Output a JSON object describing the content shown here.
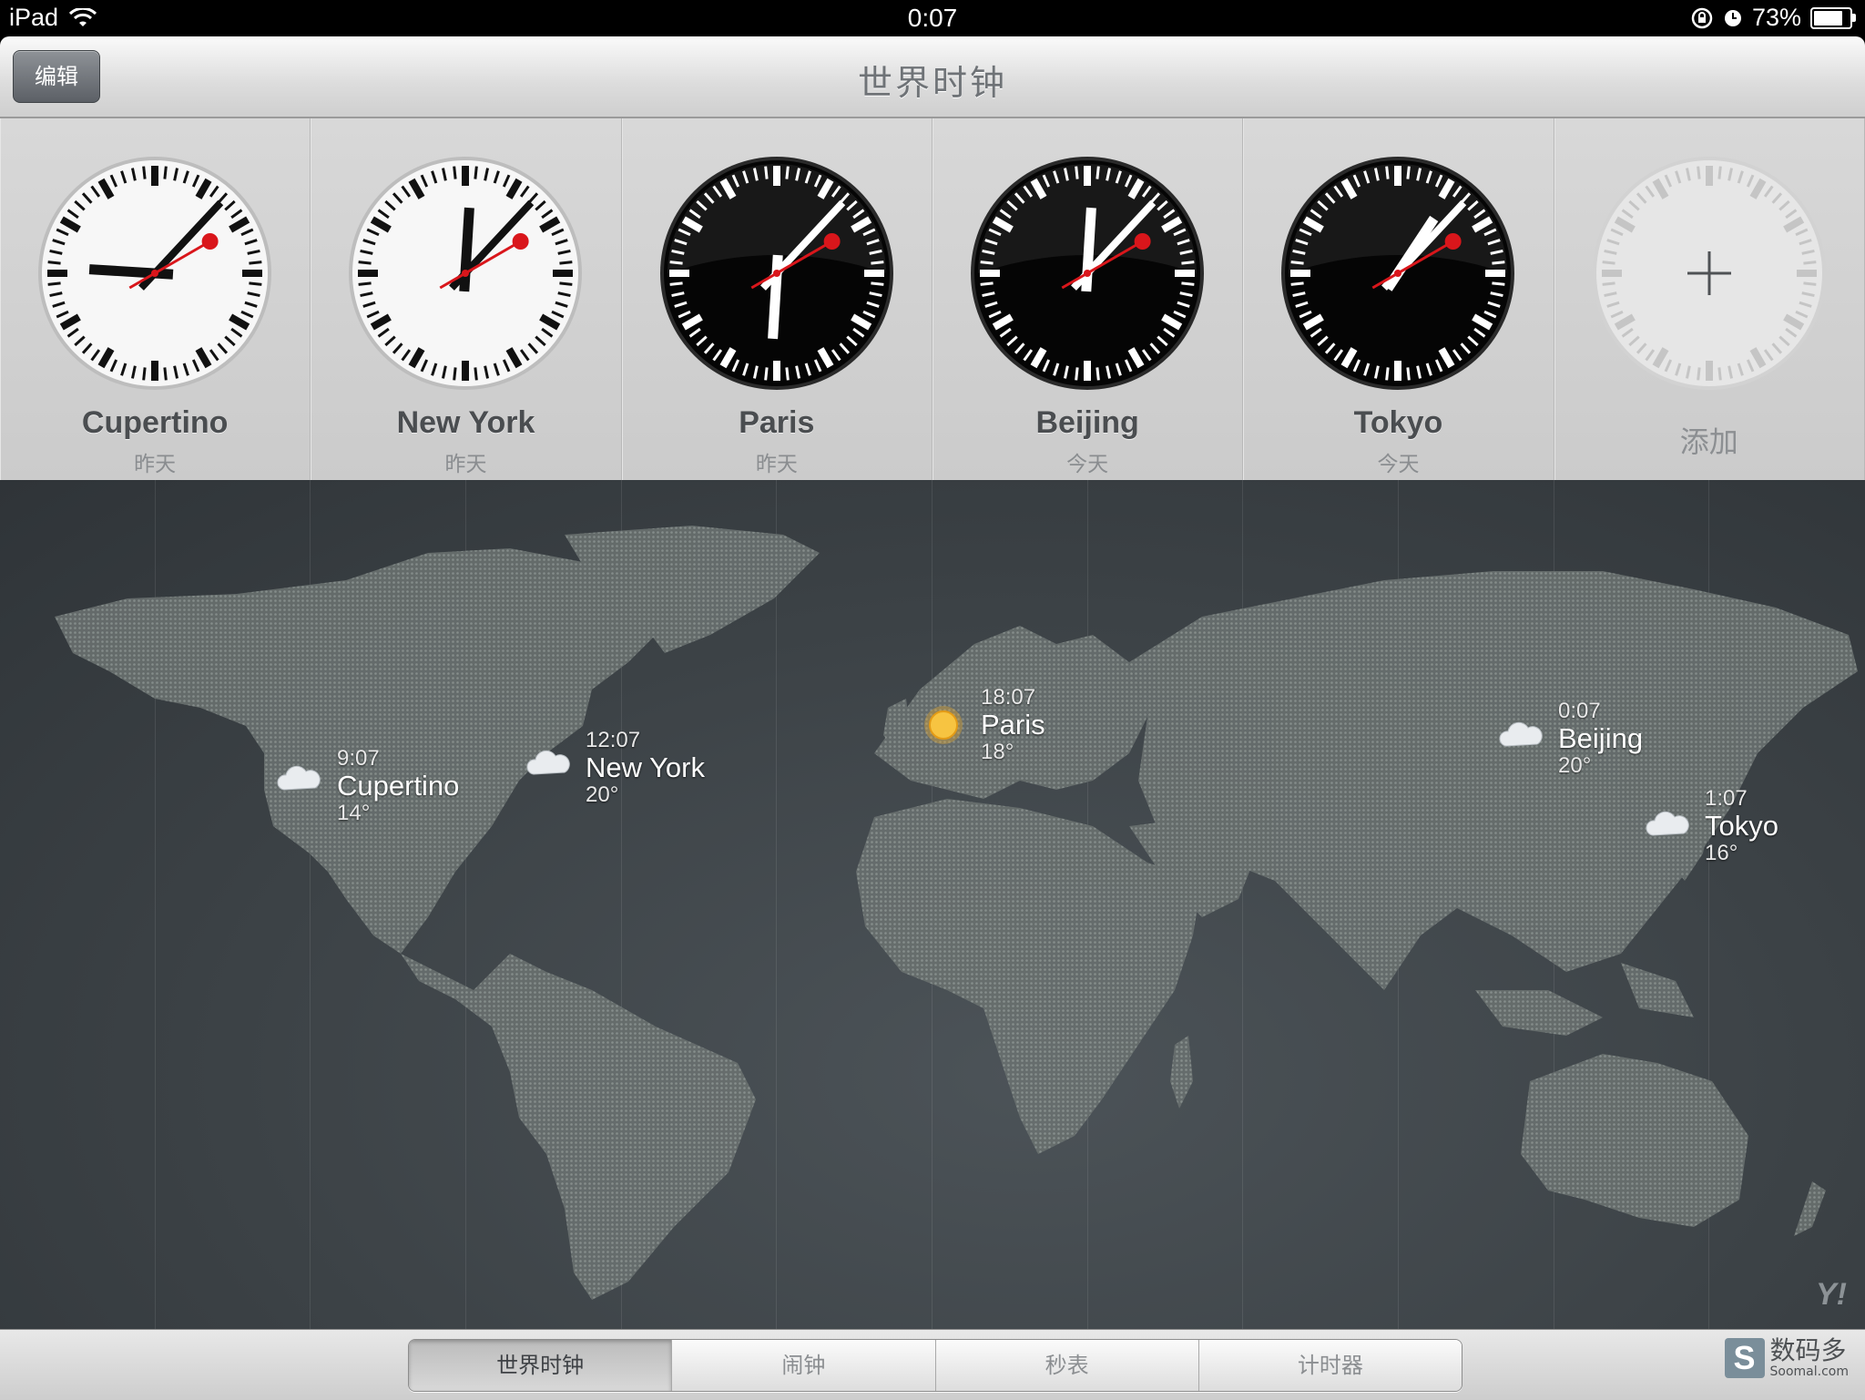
{
  "status": {
    "device": "iPad",
    "time": "0:07",
    "battery_label": "73%",
    "battery_level": 0.73
  },
  "nav": {
    "edit_label": "编辑",
    "title": "世界时钟"
  },
  "clocks": [
    {
      "city": "Cupertino",
      "day": "昨天",
      "face": "light",
      "hour": 9,
      "minute": 7,
      "second": 10
    },
    {
      "city": "New York",
      "day": "昨天",
      "face": "light",
      "hour": 12,
      "minute": 7,
      "second": 10
    },
    {
      "city": "Paris",
      "day": "昨天",
      "face": "dark",
      "hour": 18,
      "minute": 7,
      "second": 10
    },
    {
      "city": "Beijing",
      "day": "今天",
      "face": "dark",
      "hour": 0,
      "minute": 7,
      "second": 10
    },
    {
      "city": "Tokyo",
      "day": "今天",
      "face": "dark",
      "hour": 1,
      "minute": 7,
      "second": 10
    }
  ],
  "add_label": "添加",
  "map_pins": [
    {
      "time": "9:07",
      "city": "Cupertino",
      "temp": "14°",
      "weather": "cloud-icon"
    },
    {
      "time": "12:07",
      "city": "New York",
      "temp": "20°",
      "weather": "cloud-icon"
    },
    {
      "time": "18:07",
      "city": "Paris",
      "temp": "18°",
      "weather": "sun-icon"
    },
    {
      "time": "0:07",
      "city": "Beijing",
      "temp": "20°",
      "weather": "cloud-icon"
    },
    {
      "time": "1:07",
      "city": "Tokyo",
      "temp": "16°",
      "weather": "cloud-icon"
    }
  ],
  "yahoo": "Y!",
  "tabs": [
    {
      "label": "世界时钟",
      "active": true
    },
    {
      "label": "闹钟",
      "active": false
    },
    {
      "label": "秒表",
      "active": false
    },
    {
      "label": "计时器",
      "active": false
    }
  ],
  "brand": {
    "name": "数码多",
    "site": "Soomal.com"
  }
}
